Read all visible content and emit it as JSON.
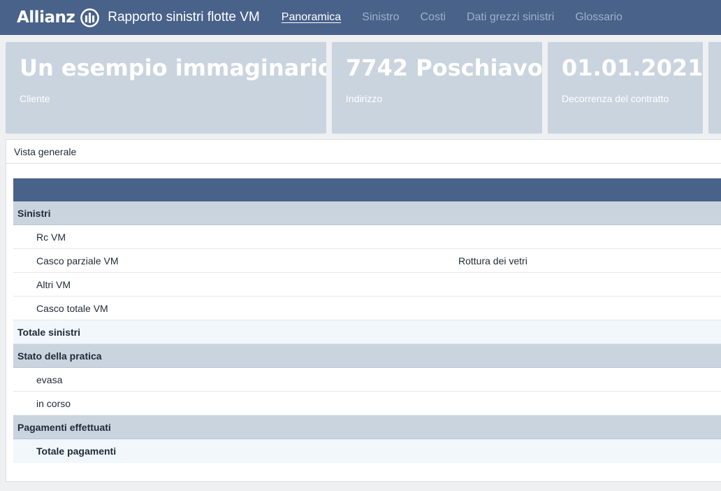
{
  "header": {
    "brand": "Allianz",
    "app_title": "Rapporto sinistri flotte VM",
    "nav": [
      {
        "label": "Panoramica",
        "active": true
      },
      {
        "label": "Sinistro",
        "active": false
      },
      {
        "label": "Costi",
        "active": false
      },
      {
        "label": "Dati grezzi sinistri",
        "active": false
      },
      {
        "label": "Glossario",
        "active": false
      }
    ]
  },
  "cards": [
    {
      "value": "Un esempio immaginario",
      "label": "Cliente"
    },
    {
      "value": "7742 Poschiavo",
      "label": "Indirizzo"
    },
    {
      "value": "01.01.2021",
      "label": "Decorrenza del contratto"
    }
  ],
  "panel": {
    "title": "Vista generale",
    "rows": [
      {
        "type": "group",
        "label": "Sinistri",
        "extra": ""
      },
      {
        "type": "item",
        "label": "Rc VM",
        "extra": ""
      },
      {
        "type": "item",
        "label": "Casco parziale VM",
        "extra": "Rottura dei vetri"
      },
      {
        "type": "item",
        "label": "Altri VM",
        "extra": ""
      },
      {
        "type": "item",
        "label": "Casco totale VM",
        "extra": ""
      },
      {
        "type": "total",
        "label": "Totale sinistri",
        "extra": ""
      },
      {
        "type": "group",
        "label": "Stato della pratica",
        "extra": ""
      },
      {
        "type": "item",
        "label": "evasa",
        "extra": ""
      },
      {
        "type": "item",
        "label": "in corso",
        "extra": ""
      },
      {
        "type": "group",
        "label": "Pagamenti effettuati",
        "extra": ""
      },
      {
        "type": "subtotal",
        "label": "Totale pagamenti",
        "extra": ""
      }
    ]
  },
  "colors": {
    "header_bg": "#49628a",
    "card_bg": "#cad4de",
    "group_row_bg": "#cad4de",
    "total_row_bg": "#f1f7fa"
  }
}
